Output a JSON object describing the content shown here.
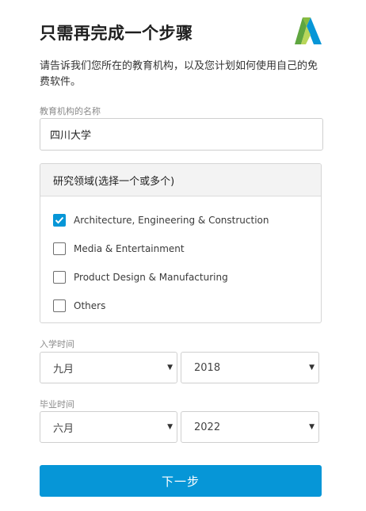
{
  "header": {
    "title": "只需再完成一个步骤",
    "logo_name": "autodesk-logo"
  },
  "description": "请告诉我们您所在的教育机构，以及您计划如何使用自己的免费软件。",
  "institution": {
    "label": "教育机构的名称",
    "value": "四川大学"
  },
  "research_area": {
    "heading": "研究领域(选择一个或多个)",
    "options": [
      {
        "label": "Architecture, Engineering & Construction",
        "checked": true
      },
      {
        "label": "Media & Entertainment",
        "checked": false
      },
      {
        "label": "Product Design & Manufacturing",
        "checked": false
      },
      {
        "label": "Others",
        "checked": false
      }
    ]
  },
  "enrollment": {
    "label": "入学时间",
    "month": "九月",
    "year": "2018"
  },
  "graduation": {
    "label": "毕业时间",
    "month": "六月",
    "year": "2022"
  },
  "next_button": "下一步",
  "colors": {
    "accent": "#0696d7"
  }
}
